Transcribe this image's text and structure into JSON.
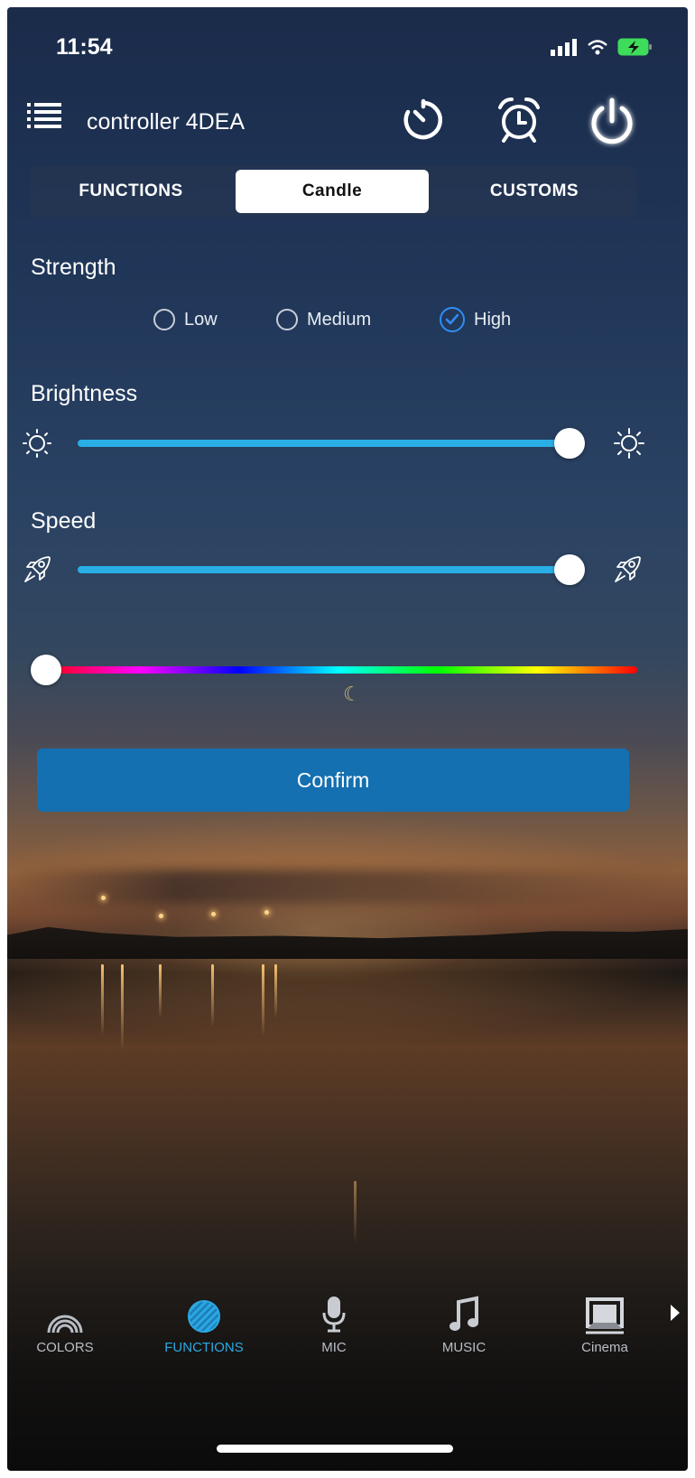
{
  "status_bar": {
    "time": "11:54"
  },
  "header": {
    "title": "controller 4DEA",
    "icons": [
      "menu-list-icon",
      "timer-icon",
      "alarm-clock-icon",
      "power-icon"
    ]
  },
  "tabs": [
    {
      "label": "FUNCTIONS",
      "active": false
    },
    {
      "label": "Candle",
      "active": true
    },
    {
      "label": "CUSTOMS",
      "active": false
    }
  ],
  "strength": {
    "label": "Strength",
    "options": [
      {
        "label": "Low",
        "selected": false
      },
      {
        "label": "Medium",
        "selected": false
      },
      {
        "label": "High",
        "selected": true
      }
    ]
  },
  "brightness": {
    "label": "Brightness",
    "value_fraction": 1.0
  },
  "speed": {
    "label": "Speed",
    "value_fraction": 1.0
  },
  "color_slider": {
    "value_fraction": 0.0
  },
  "confirm_label": "Confirm",
  "bottom_nav": [
    {
      "label": "COLORS",
      "icon": "rainbow-icon",
      "active": false
    },
    {
      "label": "FUNCTIONS",
      "icon": "striped-circle-icon",
      "active": true
    },
    {
      "label": "MIC",
      "icon": "microphone-icon",
      "active": false
    },
    {
      "label": "MUSIC",
      "icon": "music-note-icon",
      "active": false
    },
    {
      "label": "Cinema",
      "icon": "cinema-screen-icon",
      "active": false
    }
  ],
  "colors": {
    "accent": "#29aee6",
    "confirm": "#1470b0",
    "check": "#2f8df2"
  }
}
